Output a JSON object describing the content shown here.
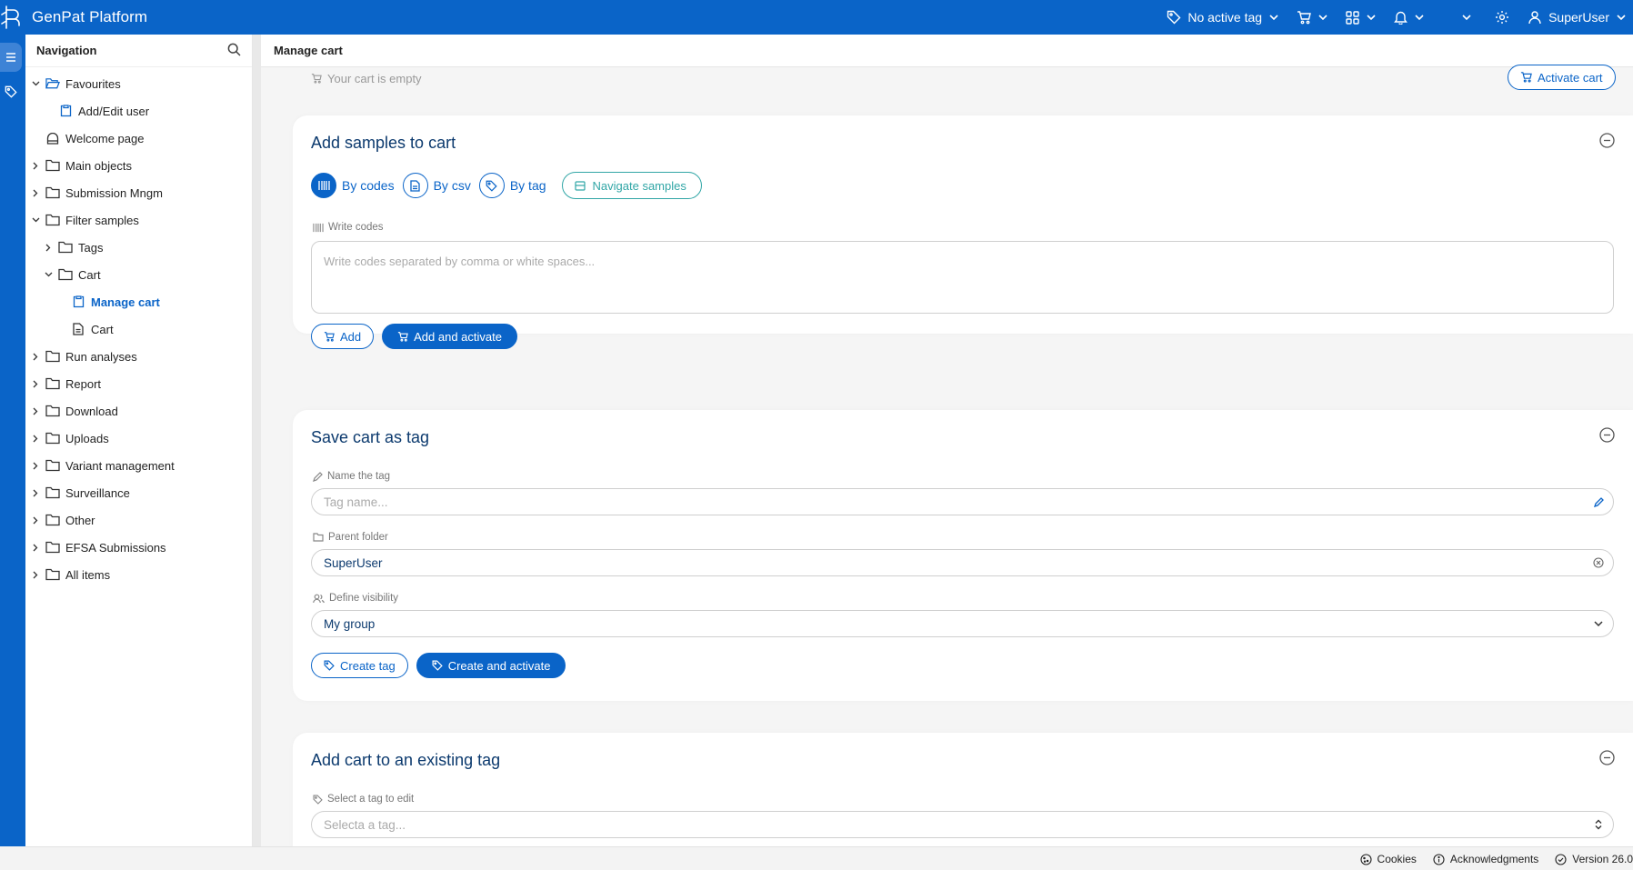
{
  "app": {
    "title": "GenPat Platform"
  },
  "topbar": {
    "tag_label": "No active tag",
    "user_label": "SuperUser"
  },
  "nav": {
    "title": "Navigation",
    "items": [
      {
        "label": "Favourites"
      },
      {
        "label": "Add/Edit user"
      },
      {
        "label": "Welcome page"
      },
      {
        "label": "Main objects"
      },
      {
        "label": "Submission Mngm"
      },
      {
        "label": "Filter samples"
      },
      {
        "label": "Tags"
      },
      {
        "label": "Cart"
      },
      {
        "label": "Manage cart"
      },
      {
        "label": "Cart"
      },
      {
        "label": "Run analyses"
      },
      {
        "label": "Report"
      },
      {
        "label": "Download"
      },
      {
        "label": "Uploads"
      },
      {
        "label": "Variant management"
      },
      {
        "label": "Surveillance"
      },
      {
        "label": "Other"
      },
      {
        "label": "EFSA Submissions"
      },
      {
        "label": "All items"
      }
    ]
  },
  "page": {
    "breadcrumb": "Manage cart",
    "cart_status": "Your cart is empty",
    "activate_cart": "Activate cart"
  },
  "add_samples": {
    "title": "Add samples to cart",
    "tabs": [
      "By codes",
      "By csv",
      "By tag"
    ],
    "navigate_label": "Navigate samples",
    "codes_label": "Write codes",
    "codes_placeholder": "Write codes separated by comma or white spaces...",
    "add_label": "Add",
    "add_activate_label": "Add and activate"
  },
  "save_tag": {
    "title": "Save cart as tag",
    "name_label": "Name the tag",
    "name_placeholder": "Tag name...",
    "parent_label": "Parent folder",
    "parent_value": "SuperUser",
    "visibility_label": "Define visibility",
    "visibility_value": "My group",
    "create_label": "Create tag",
    "create_activate_label": "Create and activate"
  },
  "existing_tag": {
    "title": "Add cart to an existing tag",
    "select_label": "Select a tag to edit",
    "select_placeholder": "Selecta a tag..."
  },
  "footer": {
    "cookies": "Cookies",
    "acknowledgments": "Acknowledgments",
    "version": "Version 26.0"
  },
  "colors": {
    "primary": "#0a64c8",
    "teal": "#31a6a6",
    "title": "#0c3a6e"
  }
}
